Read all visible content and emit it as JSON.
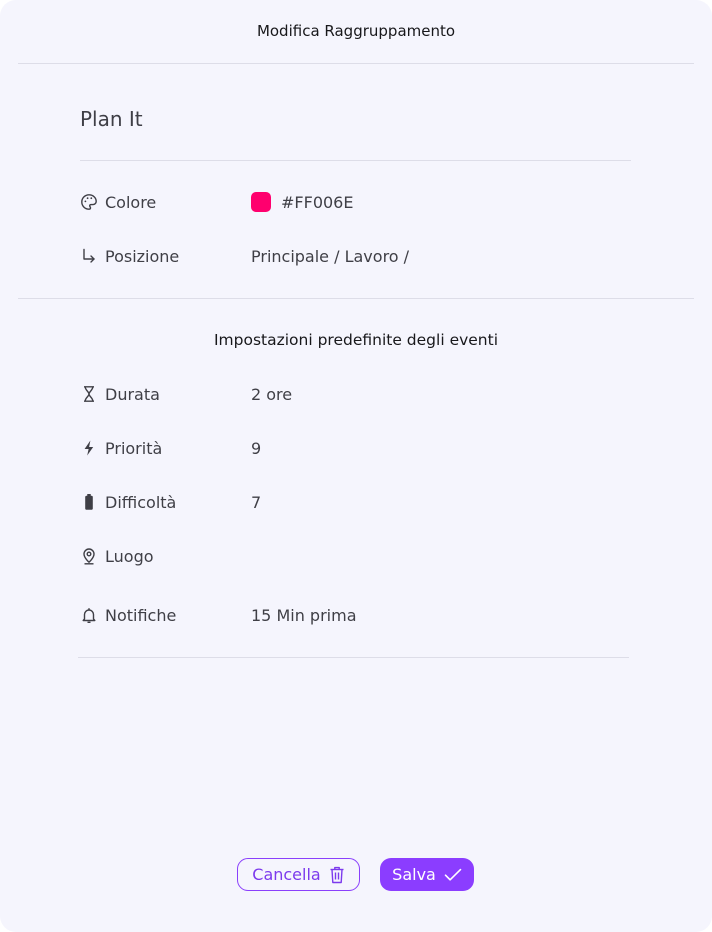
{
  "dialog": {
    "title": "Modifica Raggruppamento",
    "group_name": "Plan It"
  },
  "properties": {
    "color": {
      "label": "Colore",
      "value": "#FF006E",
      "swatch": "#FF006E",
      "icon": "palette-icon"
    },
    "position": {
      "label": "Posizione",
      "value": "Principale / Lavoro /",
      "icon": "arrow-return-right-icon"
    }
  },
  "defaults": {
    "title": "Impostazioni predefinite degli eventi",
    "duration": {
      "label": "Durata",
      "value": "2 ore",
      "icon": "hourglass-icon"
    },
    "priority": {
      "label": "Priorità",
      "value": "9",
      "icon": "lightning-icon"
    },
    "difficulty": {
      "label": "Difficoltà",
      "value": "7",
      "icon": "battery-icon"
    },
    "location": {
      "label": "Luogo",
      "value": "",
      "icon": "location-pin-icon"
    },
    "notifications": {
      "label": "Notifiche",
      "value": "15 Min prima",
      "icon": "bell-icon"
    }
  },
  "actions": {
    "cancel_label": "Cancella",
    "cancel_icon": "trash-icon",
    "save_label": "Salva",
    "save_icon": "check-icon"
  },
  "colors": {
    "background": "#F5F5FD",
    "accent": "#8B3DFF",
    "divider": "#DDDDE8"
  }
}
